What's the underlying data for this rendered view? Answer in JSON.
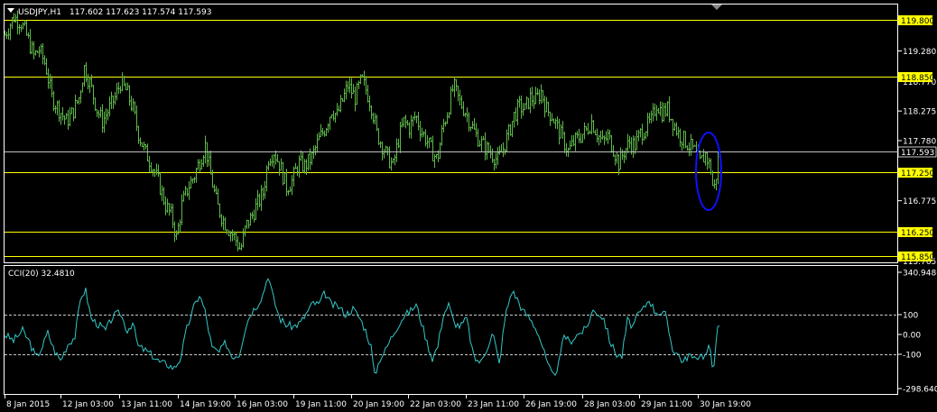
{
  "header": {
    "symbol": "USDJPY,H1",
    "ohlc": "117.602 117.623 117.574 117.593"
  },
  "colors": {
    "background": "#000000",
    "frame": "#ffffff",
    "bars": "#5fb84a",
    "levels": "#ffff00",
    "current_price_line": "#c0c0c0",
    "cci_line": "#35c6c6",
    "highlight_ellipse": "#1010ff"
  },
  "chart_data": [
    {
      "type": "ohlc",
      "title": "USDJPY,H1",
      "ylim": [
        115.75,
        119.95
      ],
      "y_ticks": [
        "119.280",
        "118.770",
        "118.275",
        "117.780",
        "116.775",
        "115.765"
      ],
      "horizontal_levels": [
        {
          "value": 119.8,
          "label": "119.800"
        },
        {
          "value": 118.85,
          "label": "118.850"
        },
        {
          "value": 117.25,
          "label": "117.250"
        },
        {
          "value": 116.25,
          "label": "116.250"
        },
        {
          "value": 115.85,
          "label": "115.850"
        }
      ],
      "current_price": {
        "value": 117.593,
        "label": "117.593"
      },
      "x_ticks": [
        "8 Jan 2015",
        "12 Jan 03:00",
        "13 Jan 11:00",
        "14 Jan 19:00",
        "16 Jan 03:00",
        "19 Jan 11:00",
        "20 Jan 19:00",
        "22 Jan 03:00",
        "23 Jan 11:00",
        "26 Jan 19:00",
        "28 Jan 03:00",
        "29 Jan 11:00",
        "30 Jan 19:00"
      ],
      "price_path": [
        [
          0,
          119.55
        ],
        [
          10,
          119.85
        ],
        [
          18,
          119.75
        ],
        [
          25,
          119.5
        ],
        [
          32,
          119.2
        ],
        [
          38,
          119.3
        ],
        [
          45,
          119.05
        ],
        [
          52,
          118.5
        ],
        [
          60,
          118.3
        ],
        [
          68,
          118.1
        ],
        [
          75,
          118.25
        ],
        [
          82,
          118.5
        ],
        [
          88,
          119.0
        ],
        [
          95,
          118.7
        ],
        [
          102,
          118.3
        ],
        [
          108,
          118.1
        ],
        [
          115,
          118.3
        ],
        [
          122,
          118.5
        ],
        [
          128,
          118.75
        ],
        [
          135,
          118.6
        ],
        [
          142,
          118.3
        ],
        [
          148,
          117.9
        ],
        [
          155,
          117.6
        ],
        [
          162,
          117.4
        ],
        [
          170,
          117.1
        ],
        [
          178,
          116.7
        ],
        [
          185,
          116.5
        ],
        [
          190,
          116.15
        ],
        [
          196,
          116.7
        ],
        [
          203,
          117.0
        ],
        [
          210,
          117.2
        ],
        [
          216,
          117.45
        ],
        [
          222,
          117.7
        ],
        [
          228,
          117.2
        ],
        [
          235,
          116.7
        ],
        [
          242,
          116.45
        ],
        [
          248,
          116.3
        ],
        [
          255,
          116.15
        ],
        [
          261,
          115.95
        ],
        [
          267,
          116.35
        ],
        [
          273,
          116.5
        ],
        [
          279,
          116.7
        ],
        [
          286,
          116.9
        ],
        [
          292,
          117.5
        ],
        [
          298,
          117.6
        ],
        [
          305,
          117.35
        ],
        [
          312,
          117.0
        ],
        [
          318,
          117.1
        ],
        [
          325,
          117.4
        ],
        [
          332,
          117.35
        ],
        [
          340,
          117.5
        ],
        [
          348,
          117.8
        ],
        [
          355,
          118.0
        ],
        [
          362,
          118.3
        ],
        [
          368,
          118.2
        ],
        [
          374,
          118.45
        ],
        [
          380,
          118.7
        ],
        [
          388,
          118.5
        ],
        [
          395,
          118.8
        ],
        [
          401,
          118.6
        ],
        [
          407,
          118.3
        ],
        [
          412,
          117.9
        ],
        [
          418,
          117.7
        ],
        [
          424,
          117.5
        ],
        [
          430,
          117.35
        ],
        [
          436,
          117.8
        ],
        [
          442,
          118.1
        ],
        [
          448,
          118.0
        ],
        [
          455,
          118.2
        ],
        [
          461,
          117.95
        ],
        [
          467,
          117.8
        ],
        [
          473,
          117.6
        ],
        [
          479,
          117.45
        ],
        [
          485,
          118.0
        ],
        [
          491,
          118.3
        ],
        [
          497,
          118.7
        ],
        [
          503,
          118.45
        ],
        [
          509,
          118.3
        ],
        [
          515,
          118.1
        ],
        [
          521,
          117.9
        ],
        [
          527,
          117.75
        ],
        [
          533,
          117.65
        ],
        [
          540,
          117.55
        ],
        [
          546,
          117.45
        ],
        [
          552,
          117.65
        ],
        [
          558,
          117.9
        ],
        [
          564,
          118.2
        ],
        [
          570,
          118.35
        ],
        [
          576,
          118.3
        ],
        [
          582,
          118.5
        ],
        [
          588,
          118.45
        ],
        [
          594,
          118.6
        ],
        [
          600,
          118.3
        ],
        [
          606,
          118.2
        ],
        [
          612,
          118.0
        ],
        [
          618,
          117.8
        ],
        [
          624,
          117.6
        ],
        [
          630,
          117.75
        ],
        [
          637,
          117.85
        ],
        [
          644,
          117.95
        ],
        [
          650,
          118.1
        ],
        [
          656,
          117.9
        ],
        [
          662,
          117.75
        ],
        [
          668,
          117.85
        ],
        [
          674,
          117.65
        ],
        [
          680,
          117.4
        ],
        [
          686,
          117.6
        ],
        [
          692,
          117.75
        ],
        [
          698,
          117.7
        ],
        [
          704,
          117.9
        ],
        [
          710,
          118.0
        ],
        [
          716,
          118.1
        ],
        [
          722,
          118.4
        ],
        [
          728,
          118.25
        ],
        [
          734,
          118.3
        ],
        [
          740,
          118.1
        ],
        [
          746,
          117.9
        ],
        [
          752,
          117.8
        ],
        [
          758,
          117.7
        ],
        [
          764,
          117.6
        ],
        [
          770,
          117.4
        ],
        [
          776,
          117.55
        ],
        [
          782,
          117.3
        ],
        [
          785,
          116.9
        ],
        [
          788,
          117.2
        ],
        [
          791,
          117.59
        ]
      ]
    },
    {
      "type": "line",
      "title": "CCI(20) 32.4810",
      "ylim": [
        -298.6405,
        340.9486
      ],
      "y_ticks": [
        "340.9486",
        "100",
        "0.00",
        "-100",
        "-298.6405"
      ],
      "reference_levels": [
        100,
        -100
      ],
      "cci_path": [
        [
          0,
          0
        ],
        [
          10,
          -30
        ],
        [
          20,
          20
        ],
        [
          28,
          -40
        ],
        [
          35,
          -120
        ],
        [
          42,
          -60
        ],
        [
          48,
          10
        ],
        [
          55,
          -80
        ],
        [
          62,
          -130
        ],
        [
          70,
          -50
        ],
        [
          78,
          -10
        ],
        [
          85,
          200
        ],
        [
          90,
          220
        ],
        [
          96,
          80
        ],
        [
          104,
          50
        ],
        [
          112,
          20
        ],
        [
          120,
          90
        ],
        [
          128,
          110
        ],
        [
          136,
          20
        ],
        [
          142,
          60
        ],
        [
          148,
          -60
        ],
        [
          156,
          -80
        ],
        [
          165,
          -110
        ],
        [
          172,
          -140
        ],
        [
          180,
          -150
        ],
        [
          188,
          -170
        ],
        [
          195,
          -120
        ],
        [
          202,
          30
        ],
        [
          210,
          140
        ],
        [
          216,
          200
        ],
        [
          222,
          120
        ],
        [
          230,
          -70
        ],
        [
          238,
          -90
        ],
        [
          245,
          -40
        ],
        [
          252,
          -110
        ],
        [
          260,
          -100
        ],
        [
          267,
          40
        ],
        [
          273,
          110
        ],
        [
          280,
          150
        ],
        [
          286,
          200
        ],
        [
          292,
          300
        ],
        [
          298,
          180
        ],
        [
          305,
          80
        ],
        [
          312,
          50
        ],
        [
          320,
          40
        ],
        [
          328,
          60
        ],
        [
          335,
          110
        ],
        [
          342,
          160
        ],
        [
          348,
          150
        ],
        [
          355,
          210
        ],
        [
          362,
          150
        ],
        [
          370,
          140
        ],
        [
          378,
          100
        ],
        [
          386,
          130
        ],
        [
          394,
          80
        ],
        [
          400,
          20
        ],
        [
          406,
          -60
        ],
        [
          410,
          -210
        ],
        [
          416,
          -120
        ],
        [
          422,
          -80
        ],
        [
          428,
          -20
        ],
        [
          435,
          40
        ],
        [
          442,
          90
        ],
        [
          450,
          120
        ],
        [
          456,
          150
        ],
        [
          462,
          60
        ],
        [
          468,
          -40
        ],
        [
          474,
          -120
        ],
        [
          480,
          -60
        ],
        [
          486,
          100
        ],
        [
          492,
          150
        ],
        [
          498,
          60
        ],
        [
          505,
          40
        ],
        [
          512,
          80
        ],
        [
          520,
          -120
        ],
        [
          528,
          -140
        ],
        [
          535,
          -60
        ],
        [
          541,
          10
        ],
        [
          548,
          -150
        ],
        [
          555,
          100
        ],
        [
          562,
          220
        ],
        [
          568,
          180
        ],
        [
          574,
          120
        ],
        [
          582,
          80
        ],
        [
          590,
          20
        ],
        [
          596,
          -60
        ],
        [
          602,
          -160
        ],
        [
          608,
          -210
        ],
        [
          614,
          -150
        ],
        [
          620,
          0
        ],
        [
          626,
          -40
        ],
        [
          632,
          -10
        ],
        [
          638,
          10
        ],
        [
          645,
          30
        ],
        [
          651,
          120
        ],
        [
          657,
          110
        ],
        [
          664,
          80
        ],
        [
          671,
          -40
        ],
        [
          678,
          -100
        ],
        [
          684,
          -110
        ],
        [
          690,
          70
        ],
        [
          696,
          40
        ],
        [
          702,
          100
        ],
        [
          708,
          130
        ],
        [
          714,
          180
        ],
        [
          720,
          120
        ],
        [
          726,
          110
        ],
        [
          732,
          100
        ],
        [
          740,
          -70
        ],
        [
          746,
          -100
        ],
        [
          752,
          -140
        ],
        [
          758,
          -100
        ],
        [
          764,
          -130
        ],
        [
          770,
          -100
        ],
        [
          776,
          -110
        ],
        [
          781,
          -60
        ],
        [
          785,
          -190
        ],
        [
          789,
          20
        ],
        [
          792,
          32.48
        ]
      ]
    }
  ]
}
